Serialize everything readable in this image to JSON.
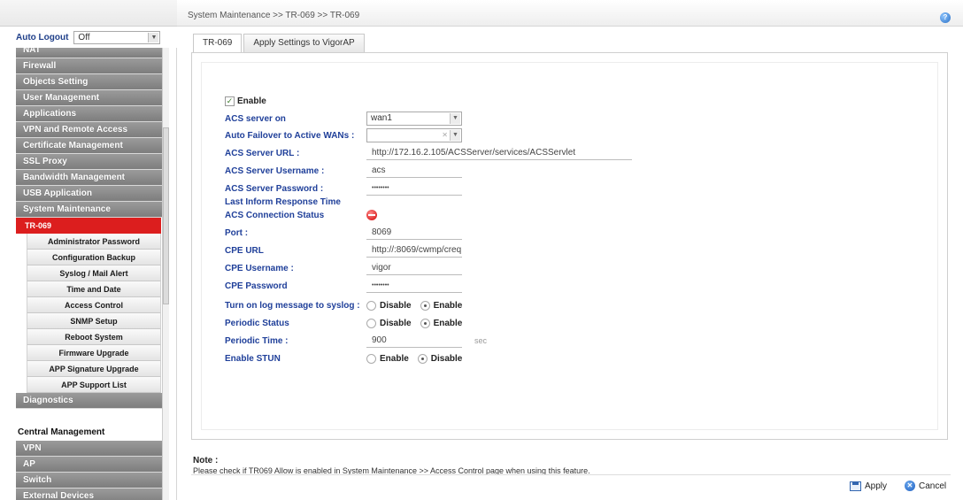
{
  "sidebar": {
    "auto_logout": {
      "label": "Auto Logout",
      "value": "Off"
    },
    "menu": [
      {
        "type": "cut",
        "label": "NAT"
      },
      {
        "type": "mi",
        "label": "Firewall"
      },
      {
        "type": "mi",
        "label": "Objects Setting"
      },
      {
        "type": "mi",
        "label": "User Management"
      },
      {
        "type": "mi",
        "label": "Applications"
      },
      {
        "type": "mi",
        "label": "VPN and Remote Access"
      },
      {
        "type": "mi",
        "label": "Certificate Management"
      },
      {
        "type": "mi",
        "label": "SSL Proxy"
      },
      {
        "type": "mi",
        "label": "Bandwidth Management"
      },
      {
        "type": "mi",
        "label": "USB Application"
      },
      {
        "type": "mi",
        "label": "System Maintenance"
      },
      {
        "type": "sub-active",
        "label": "TR-069"
      },
      {
        "type": "sub",
        "label": "Administrator Password"
      },
      {
        "type": "sub",
        "label": "Configuration Backup"
      },
      {
        "type": "sub",
        "label": "Syslog / Mail Alert"
      },
      {
        "type": "sub",
        "label": "Time and Date"
      },
      {
        "type": "sub",
        "label": "Access Control"
      },
      {
        "type": "sub",
        "label": "SNMP Setup"
      },
      {
        "type": "sub",
        "label": "Reboot System"
      },
      {
        "type": "sub",
        "label": "Firmware Upgrade"
      },
      {
        "type": "sub",
        "label": "APP Signature Upgrade"
      },
      {
        "type": "sub",
        "label": "APP Support List"
      },
      {
        "type": "mi",
        "label": "Diagnostics"
      },
      {
        "type": "gap",
        "label": ""
      },
      {
        "type": "plain",
        "label": "Central Management"
      },
      {
        "type": "mi",
        "label": "VPN"
      },
      {
        "type": "mi",
        "label": "AP"
      },
      {
        "type": "mi",
        "label": "Switch"
      },
      {
        "type": "mi",
        "label": "External Devices"
      }
    ]
  },
  "header": {
    "breadcrumb": "System Maintenance >> TR-069 >> TR-069",
    "help_icon": "help-icon"
  },
  "tabs": [
    {
      "label": "TR-069",
      "active": true
    },
    {
      "label": "Apply Settings to VigorAP",
      "active": false
    }
  ],
  "form": {
    "enable_label": "Enable",
    "enable_checked": true,
    "acs_server_on": {
      "label": "ACS server on",
      "value": "wan1"
    },
    "auto_failover": {
      "label": "Auto Failover to Active WANs :",
      "value": ""
    },
    "acs_server_url": {
      "label": "ACS Server URL :",
      "value": "http://172.16.2.105/ACSServer/services/ACSServlet"
    },
    "acs_username": {
      "label": "ACS Server Username :",
      "value": "acs"
    },
    "acs_password": {
      "label": "ACS Server Password :",
      "value": "••••••••"
    },
    "last_inform": {
      "label": "Last Inform Response Time"
    },
    "acs_connection_status": {
      "label": "ACS Connection Status",
      "status_color": "#d00000"
    },
    "port": {
      "label": "Port :",
      "value": "8069"
    },
    "cpe_url": {
      "label": "CPE URL",
      "value": "http://:8069/cwmp/creq"
    },
    "cpe_username": {
      "label": "CPE Username :",
      "value": "vigor"
    },
    "cpe_password": {
      "label": "CPE Password",
      "value": "••••••••"
    },
    "log_to_syslog": {
      "label": "Turn on log message to syslog :",
      "options": [
        "Disable",
        "Enable"
      ],
      "selected": "Enable"
    },
    "periodic_status": {
      "label": "Periodic Status",
      "options": [
        "Disable",
        "Enable"
      ],
      "selected": "Enable"
    },
    "periodic_time": {
      "label": "Periodic Time :",
      "value": "900",
      "unit": "sec"
    },
    "enable_stun": {
      "label": "Enable STUN",
      "options": [
        "Enable",
        "Disable"
      ],
      "selected": "Disable"
    }
  },
  "note": {
    "title": "Note :",
    "text": "Please check if TR069 Allow is enabled in System Maintenance >> Access Control page when using this feature."
  },
  "buttons": {
    "apply": "Apply",
    "cancel": "Cancel"
  },
  "colors": {
    "accent_red": "#dc1e1e",
    "label_blue": "#20409a",
    "menu_gray": "#8c8c8c"
  }
}
